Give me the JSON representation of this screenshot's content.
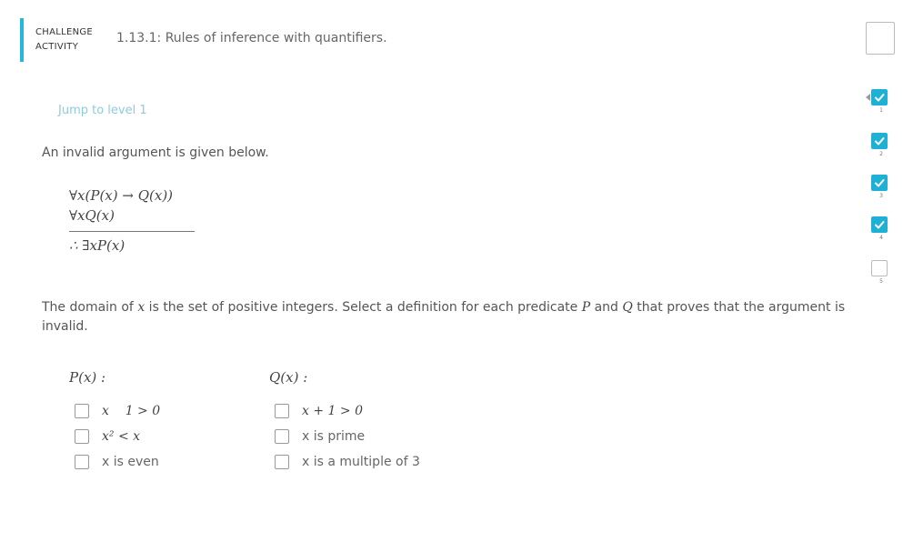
{
  "header": {
    "badge_line1": "CHALLENGE",
    "badge_line2": "ACTIVITY",
    "title": "1.13.1: Rules of inference with quantifiers.",
    "accent_color": "#24b8d9"
  },
  "progress": {
    "levels": [
      {
        "number": "1",
        "status": "complete",
        "current": true
      },
      {
        "number": "2",
        "status": "complete",
        "current": false
      },
      {
        "number": "3",
        "status": "complete",
        "current": false
      },
      {
        "number": "4",
        "status": "complete",
        "current": false
      },
      {
        "number": "5",
        "status": "incomplete",
        "current": false
      }
    ],
    "check_icon": "check-icon"
  },
  "jump": {
    "label": "Jump to level 1"
  },
  "problem": {
    "intro": "An invalid argument is given below.",
    "premise1": "∀x(P(x) → Q(x))",
    "premise2": "∀xQ(x)",
    "conclusion": "∴ ∃xP(x)",
    "domain_pre": "The domain of ",
    "domain_var": "x",
    "domain_mid": " is the set of positive integers. Select a definition for each predicate ",
    "domain_p": "P",
    "domain_and": " and ",
    "domain_q": "Q",
    "domain_post": " that proves that the argument is invalid."
  },
  "p_column": {
    "heading": "P(x) :",
    "options": [
      {
        "label": "x    1 > 0",
        "checked": false,
        "math": true
      },
      {
        "label": "x² < x",
        "checked": false,
        "math": true
      },
      {
        "label": "x is even",
        "checked": false,
        "math": false
      }
    ]
  },
  "q_column": {
    "heading": "Q(x) :",
    "options": [
      {
        "label": "x + 1 > 0",
        "checked": false,
        "math": true
      },
      {
        "label": "x is prime",
        "checked": false,
        "math": false
      },
      {
        "label": "x is a multiple of 3",
        "checked": false,
        "math": false
      }
    ]
  }
}
